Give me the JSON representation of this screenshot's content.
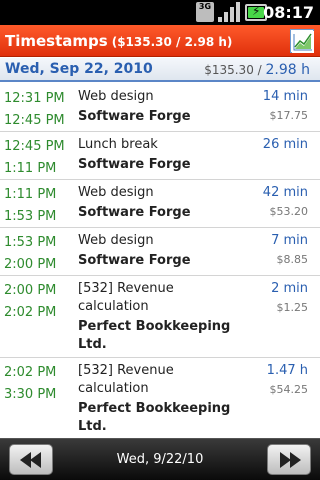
{
  "statusbar": {
    "network": "3G",
    "time": "08:17",
    "icons": [
      "3g-icon",
      "signal-icon",
      "battery-icon"
    ]
  },
  "titlebar": {
    "title": "Timestamps",
    "summary": "($135.30 / 2.98 h)",
    "chart_icon": "chart-icon",
    "color": "#e8380f"
  },
  "day": {
    "date": "Wed, Sep 22, 2010",
    "total_money": "$135.30",
    "total_duration": "2.98 h"
  },
  "entries": [
    {
      "start": "12:31 PM",
      "end": "12:45 PM",
      "activity": "Web design",
      "client": "Software Forge",
      "duration": "14 min",
      "money": "$17.75"
    },
    {
      "start": "12:45 PM",
      "end": "1:11 PM",
      "activity": "Lunch break",
      "client": "Software Forge",
      "duration": "26 min",
      "money": ""
    },
    {
      "start": "1:11 PM",
      "end": "1:53 PM",
      "activity": "Web design",
      "client": "Software Forge",
      "duration": "42 min",
      "money": "$53.20"
    },
    {
      "start": "1:53 PM",
      "end": "2:00 PM",
      "activity": "Web design",
      "client": "Software Forge",
      "duration": "7 min",
      "money": "$8.85"
    },
    {
      "start": "2:00 PM",
      "end": "2:02 PM",
      "activity": "[532] Revenue calculation",
      "client": "Perfect Bookkeeping Ltd.",
      "duration": "2 min",
      "money": "$1.25"
    },
    {
      "start": "2:02 PM",
      "end": "3:30 PM",
      "activity": "[532] Revenue calculation",
      "client": "Perfect Bookkeeping Ltd.",
      "duration": "1.47 h",
      "money": "$54.25"
    }
  ],
  "bottombar": {
    "date": "Wed, 9/22/10",
    "prev_icon": "rewind-icon",
    "next_icon": "fast-forward-icon"
  }
}
